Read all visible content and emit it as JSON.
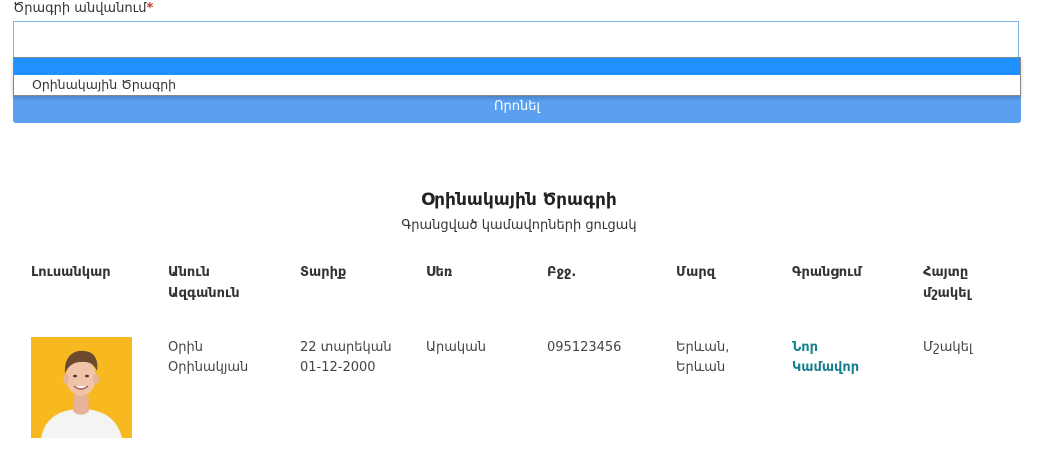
{
  "form": {
    "field_label": "Ծրագրի անվանում",
    "required_mark": "*",
    "selected_value": "",
    "options": [
      "",
      "Օրինակային Ծրագրի"
    ],
    "search_button": "Որոնել"
  },
  "report": {
    "title": "Օրինակային Ծրագրի",
    "subtitle": "Գրանցված կամավորների ցուցակ",
    "columns": [
      {
        "line1": "Լուսանկար",
        "line2": ""
      },
      {
        "line1": "Անուն",
        "line2": "Ազգանուն"
      },
      {
        "line1": "Տարիք",
        "line2": ""
      },
      {
        "line1": "Սեռ",
        "line2": ""
      },
      {
        "line1": "Բջջ.",
        "line2": ""
      },
      {
        "line1": "Մարզ",
        "line2": ""
      },
      {
        "line1": "Գրանցում",
        "line2": ""
      },
      {
        "line1": "Հայտը",
        "line2": "մշակել"
      }
    ],
    "rows": [
      {
        "name_line1": "Օրին",
        "name_line2": "Օրինակյան",
        "age_line1": "22 տարեկան",
        "age_line2": "01-12-2000",
        "gender": "Արական",
        "phone": "095123456",
        "region_line1": "Երևան,",
        "region_line2": "Երևան",
        "registration_line1": "Նոր",
        "registration_line2": "Կամավոր",
        "action": "Մշակել"
      }
    ]
  },
  "colors": {
    "accent": "#5b9ff0",
    "highlight": "#1e90ff",
    "link": "#1a7f8e",
    "required": "#c0392b",
    "photo_bg": "#f7b820"
  }
}
